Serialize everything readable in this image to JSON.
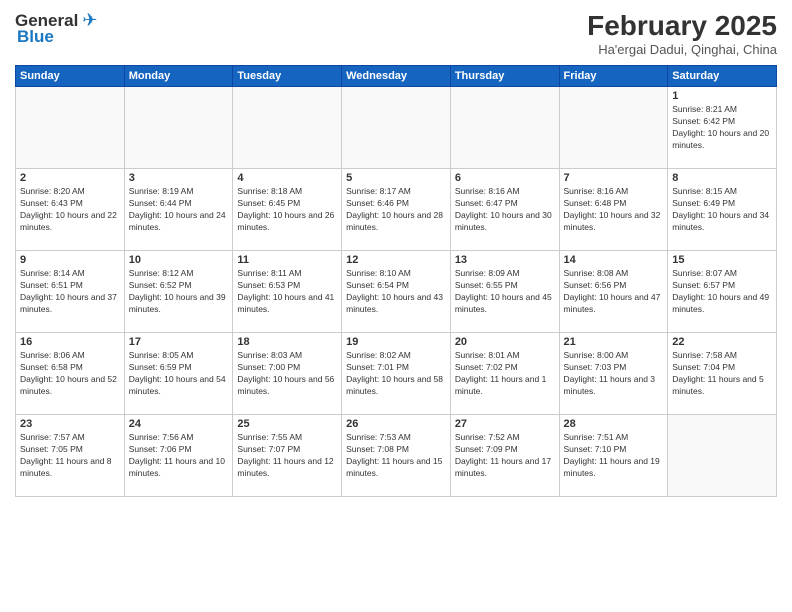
{
  "header": {
    "logo_general": "General",
    "logo_blue": "Blue",
    "title": "February 2025",
    "location": "Ha'ergai Dadui, Qinghai, China"
  },
  "weekdays": [
    "Sunday",
    "Monday",
    "Tuesday",
    "Wednesday",
    "Thursday",
    "Friday",
    "Saturday"
  ],
  "weeks": [
    [
      {
        "day": "",
        "info": ""
      },
      {
        "day": "",
        "info": ""
      },
      {
        "day": "",
        "info": ""
      },
      {
        "day": "",
        "info": ""
      },
      {
        "day": "",
        "info": ""
      },
      {
        "day": "",
        "info": ""
      },
      {
        "day": "1",
        "info": "Sunrise: 8:21 AM\nSunset: 6:42 PM\nDaylight: 10 hours and 20 minutes."
      }
    ],
    [
      {
        "day": "2",
        "info": "Sunrise: 8:20 AM\nSunset: 6:43 PM\nDaylight: 10 hours and 22 minutes."
      },
      {
        "day": "3",
        "info": "Sunrise: 8:19 AM\nSunset: 6:44 PM\nDaylight: 10 hours and 24 minutes."
      },
      {
        "day": "4",
        "info": "Sunrise: 8:18 AM\nSunset: 6:45 PM\nDaylight: 10 hours and 26 minutes."
      },
      {
        "day": "5",
        "info": "Sunrise: 8:17 AM\nSunset: 6:46 PM\nDaylight: 10 hours and 28 minutes."
      },
      {
        "day": "6",
        "info": "Sunrise: 8:16 AM\nSunset: 6:47 PM\nDaylight: 10 hours and 30 minutes."
      },
      {
        "day": "7",
        "info": "Sunrise: 8:16 AM\nSunset: 6:48 PM\nDaylight: 10 hours and 32 minutes."
      },
      {
        "day": "8",
        "info": "Sunrise: 8:15 AM\nSunset: 6:49 PM\nDaylight: 10 hours and 34 minutes."
      }
    ],
    [
      {
        "day": "9",
        "info": "Sunrise: 8:14 AM\nSunset: 6:51 PM\nDaylight: 10 hours and 37 minutes."
      },
      {
        "day": "10",
        "info": "Sunrise: 8:12 AM\nSunset: 6:52 PM\nDaylight: 10 hours and 39 minutes."
      },
      {
        "day": "11",
        "info": "Sunrise: 8:11 AM\nSunset: 6:53 PM\nDaylight: 10 hours and 41 minutes."
      },
      {
        "day": "12",
        "info": "Sunrise: 8:10 AM\nSunset: 6:54 PM\nDaylight: 10 hours and 43 minutes."
      },
      {
        "day": "13",
        "info": "Sunrise: 8:09 AM\nSunset: 6:55 PM\nDaylight: 10 hours and 45 minutes."
      },
      {
        "day": "14",
        "info": "Sunrise: 8:08 AM\nSunset: 6:56 PM\nDaylight: 10 hours and 47 minutes."
      },
      {
        "day": "15",
        "info": "Sunrise: 8:07 AM\nSunset: 6:57 PM\nDaylight: 10 hours and 49 minutes."
      }
    ],
    [
      {
        "day": "16",
        "info": "Sunrise: 8:06 AM\nSunset: 6:58 PM\nDaylight: 10 hours and 52 minutes."
      },
      {
        "day": "17",
        "info": "Sunrise: 8:05 AM\nSunset: 6:59 PM\nDaylight: 10 hours and 54 minutes."
      },
      {
        "day": "18",
        "info": "Sunrise: 8:03 AM\nSunset: 7:00 PM\nDaylight: 10 hours and 56 minutes."
      },
      {
        "day": "19",
        "info": "Sunrise: 8:02 AM\nSunset: 7:01 PM\nDaylight: 10 hours and 58 minutes."
      },
      {
        "day": "20",
        "info": "Sunrise: 8:01 AM\nSunset: 7:02 PM\nDaylight: 11 hours and 1 minute."
      },
      {
        "day": "21",
        "info": "Sunrise: 8:00 AM\nSunset: 7:03 PM\nDaylight: 11 hours and 3 minutes."
      },
      {
        "day": "22",
        "info": "Sunrise: 7:58 AM\nSunset: 7:04 PM\nDaylight: 11 hours and 5 minutes."
      }
    ],
    [
      {
        "day": "23",
        "info": "Sunrise: 7:57 AM\nSunset: 7:05 PM\nDaylight: 11 hours and 8 minutes."
      },
      {
        "day": "24",
        "info": "Sunrise: 7:56 AM\nSunset: 7:06 PM\nDaylight: 11 hours and 10 minutes."
      },
      {
        "day": "25",
        "info": "Sunrise: 7:55 AM\nSunset: 7:07 PM\nDaylight: 11 hours and 12 minutes."
      },
      {
        "day": "26",
        "info": "Sunrise: 7:53 AM\nSunset: 7:08 PM\nDaylight: 11 hours and 15 minutes."
      },
      {
        "day": "27",
        "info": "Sunrise: 7:52 AM\nSunset: 7:09 PM\nDaylight: 11 hours and 17 minutes."
      },
      {
        "day": "28",
        "info": "Sunrise: 7:51 AM\nSunset: 7:10 PM\nDaylight: 11 hours and 19 minutes."
      },
      {
        "day": "",
        "info": ""
      }
    ]
  ]
}
